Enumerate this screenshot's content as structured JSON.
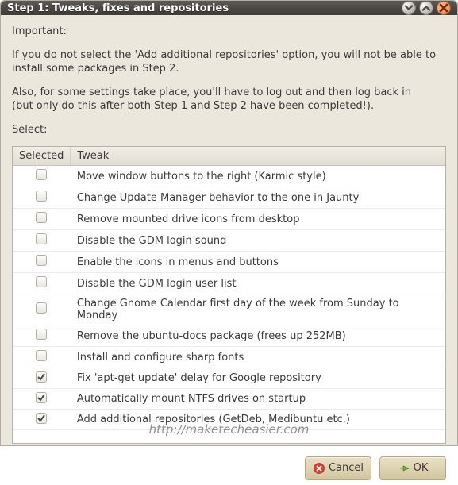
{
  "window": {
    "title": "Step 1: Tweaks, fixes and repositories"
  },
  "intro": {
    "important_label": "Important:",
    "p1": "If you do not select the 'Add additional repositories' option, you will not be able to install some packages in Step 2.",
    "p2a": "Also, for some settings take place, you'll have to log out and then log back in",
    "p2b": "(but only do this after both Step 1 and Step 2 have been completed!).",
    "select_label": "Select:"
  },
  "table": {
    "header_selected": "Selected",
    "header_tweak": "Tweak",
    "rows": [
      {
        "checked": false,
        "label": "Move window buttons to the right (Karmic style)"
      },
      {
        "checked": false,
        "label": "Change Update Manager behavior to the one in Jaunty"
      },
      {
        "checked": false,
        "label": "Remove mounted drive icons from desktop"
      },
      {
        "checked": false,
        "label": "Disable the GDM login sound"
      },
      {
        "checked": false,
        "label": "Enable the icons in menus and buttons"
      },
      {
        "checked": false,
        "label": "Disable the GDM login user list"
      },
      {
        "checked": false,
        "label": "Change Gnome Calendar first day of the week from Sunday to Monday"
      },
      {
        "checked": false,
        "label": "Remove the ubuntu-docs package (frees up 252MB)"
      },
      {
        "checked": false,
        "label": "Install and configure sharp fonts"
      },
      {
        "checked": true,
        "label": "Fix 'apt-get update' delay for Google repository"
      },
      {
        "checked": true,
        "label": "Automatically mount NTFS drives on startup"
      },
      {
        "checked": true,
        "label": "Add additional repositories (GetDeb, Medibuntu etc.)"
      }
    ]
  },
  "buttons": {
    "cancel": "Cancel",
    "ok": "OK"
  },
  "watermark": "http://maketecheasier.com"
}
